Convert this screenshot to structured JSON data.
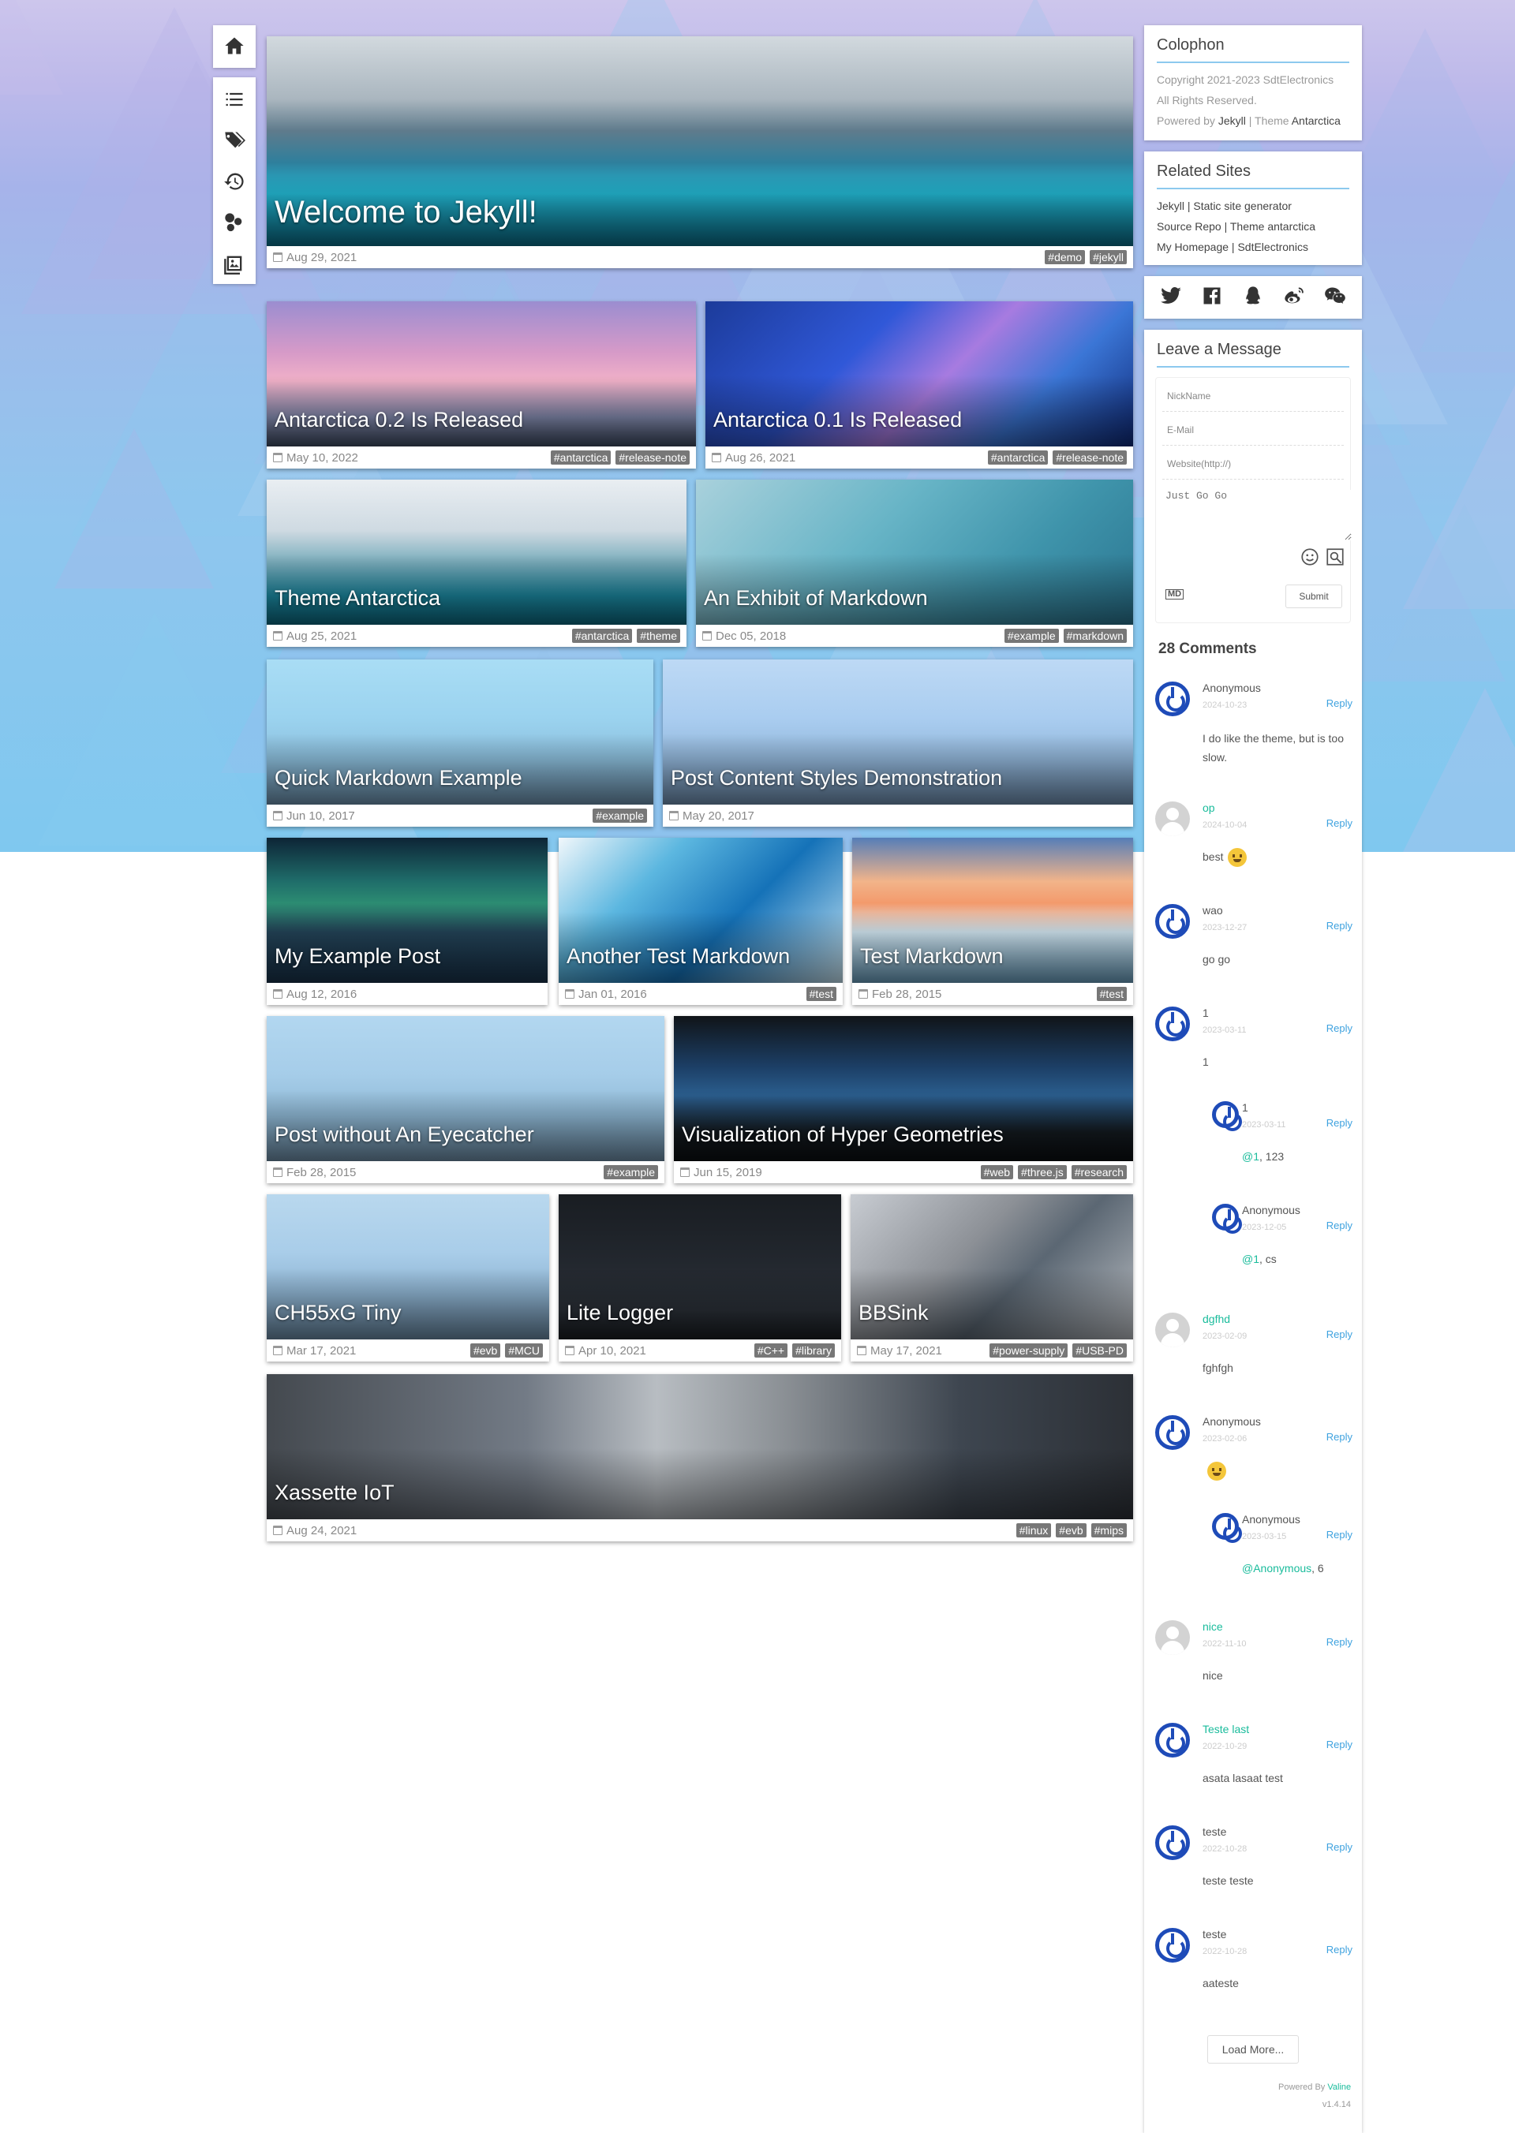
{
  "nav": {
    "items": [
      {
        "icon": "home-icon"
      },
      {
        "icon": "list-icon"
      },
      {
        "icon": "tags-icon"
      },
      {
        "icon": "history-icon"
      },
      {
        "icon": "categories-icon"
      },
      {
        "icon": "gallery-icon"
      }
    ]
  },
  "posts": {
    "welcome": {
      "title": "Welcome to Jekyll!",
      "date": "Aug 29, 2021",
      "tags": [
        "#demo",
        "#jekyll"
      ]
    },
    "antarctica02": {
      "title": "Antarctica 0.2 Is Released",
      "date": "May 10, 2022",
      "tags": [
        "#antarctica",
        "#release-note"
      ]
    },
    "antarctica01": {
      "title": "Antarctica 0.1 Is Released",
      "date": "Aug 26, 2021",
      "tags": [
        "#antarctica",
        "#release-note"
      ]
    },
    "theme": {
      "title": "Theme Antarctica",
      "date": "Aug 25, 2021",
      "tags": [
        "#antarctica",
        "#theme"
      ]
    },
    "exhibit": {
      "title": "An Exhibit of Markdown",
      "date": "Dec 05, 2018",
      "tags": [
        "#example",
        "#markdown"
      ]
    },
    "quick": {
      "title": "Quick Markdown Example",
      "date": "Jun 10, 2017",
      "tags": [
        "#example"
      ]
    },
    "content": {
      "title": "Post Content Styles Demonstration",
      "date": "May 20, 2017",
      "tags": []
    },
    "myexample": {
      "title": "My Example Post",
      "date": "Aug 12, 2016",
      "tags": []
    },
    "another": {
      "title": "Another Test Markdown",
      "date": "Jan 01, 2016",
      "tags": [
        "#test"
      ]
    },
    "test": {
      "title": "Test Markdown",
      "date": "Feb 28, 2015",
      "tags": [
        "#test"
      ]
    },
    "noeye": {
      "title": "Post without An Eyecatcher",
      "date": "Feb 28, 2015",
      "tags": [
        "#example"
      ]
    },
    "hyper": {
      "title": "Visualization of Hyper Geometries",
      "date": "Jun 15, 2019",
      "tags": [
        "#web",
        "#three.js",
        "#research"
      ]
    },
    "ch55x": {
      "title": "CH55xG Tiny",
      "date": "Mar 17, 2021",
      "tags": [
        "#evb",
        "#MCU"
      ]
    },
    "litelogger": {
      "title": "Lite Logger",
      "date": "Apr 10, 2021",
      "tags": [
        "#C++",
        "#library"
      ]
    },
    "bbsink": {
      "title": "BBSink",
      "date": "May 17, 2021",
      "tags": [
        "#power-supply",
        "#USB-PD"
      ]
    },
    "xassette": {
      "title": "Xassette IoT",
      "date": "Aug 24, 2021",
      "tags": [
        "#linux",
        "#evb",
        "#mips"
      ]
    }
  },
  "colophon": {
    "title": "Colophon",
    "copyright": "Copyright 2021-2023 SdtElectronics",
    "rights": "All Rights Reserved.",
    "powered_prefix": "Powered by",
    "jekyll": "Jekyll",
    "sep": "|",
    "theme_prefix": "Theme",
    "theme": "Antarctica"
  },
  "related": {
    "title": "Related Sites",
    "links": [
      "Jekyll | Static site generator",
      "Source Repo | Theme antarctica",
      "My Homepage | SdtElectronics"
    ]
  },
  "social": [
    "twitter-icon",
    "facebook-icon",
    "qq-icon",
    "weibo-icon",
    "wechat-icon"
  ],
  "message": {
    "title": "Leave a Message",
    "nick_placeholder": "NickName",
    "email_placeholder": "E-Mail",
    "website_placeholder": "Website(http://)",
    "comment_placeholder": "Just Go Go",
    "md_label": "MD",
    "submit": "Submit",
    "count": "28 Comments",
    "load_more": "Load More...",
    "powered_by": "Powered By",
    "valine": "Valine",
    "version": "v1.4.14"
  },
  "comments": [
    {
      "nick": "Anonymous",
      "time": "2024-10-23",
      "reply": "Reply",
      "text": "I do like the theme, but is too slow.",
      "avatar": "blue"
    },
    {
      "nick": "op",
      "time": "2024-10-04",
      "reply": "Reply",
      "text": "best",
      "avatar": "gray",
      "emoji": "grin-emoji"
    },
    {
      "nick": "wao",
      "time": "2023-12-27",
      "reply": "Reply",
      "text": "go go",
      "avatar": "blue"
    },
    {
      "nick": "1",
      "time": "2023-03-11",
      "reply": "Reply",
      "text": "1",
      "avatar": "blue"
    },
    {
      "nick": "1",
      "time": "2023-03-11",
      "reply": "Reply",
      "at": "@1",
      "text": ", 123",
      "avatar": "blue"
    },
    {
      "nick": "Anonymous",
      "time": "2023-12-05",
      "reply": "Reply",
      "at": "@1",
      "text": ", cs",
      "avatar": "blue"
    },
    {
      "nick": "dgfhd",
      "time": "2023-02-09",
      "reply": "Reply",
      "text": "fghfgh",
      "avatar": "gray"
    },
    {
      "nick": "Anonymous",
      "time": "2023-02-06",
      "reply": "Reply",
      "text": "",
      "avatar": "blue",
      "emoji": "laugh-emoji"
    },
    {
      "nick": "Anonymous",
      "time": "2023-03-15",
      "reply": "Reply",
      "at": "@Anonymous",
      "text": ", 6",
      "avatar": "blue"
    },
    {
      "nick": "nice",
      "time": "2022-11-10",
      "reply": "Reply",
      "text": "nice",
      "avatar": "gray"
    },
    {
      "nick": "Teste last",
      "time": "2022-10-29",
      "reply": "Reply",
      "text": "asata lasaat test",
      "avatar": "blue"
    },
    {
      "nick": "teste",
      "time": "2022-10-28",
      "reply": "Reply",
      "text": "teste teste",
      "avatar": "blue"
    },
    {
      "nick": "teste",
      "time": "2022-10-28",
      "reply": "Reply",
      "text": "aateste",
      "avatar": "blue"
    }
  ],
  "colors": {
    "accent": "#8cc9ee",
    "link": "#1abc9c",
    "reply": "#3ea2df",
    "avatar": "#1e4bb8",
    "tag": "#777777"
  }
}
